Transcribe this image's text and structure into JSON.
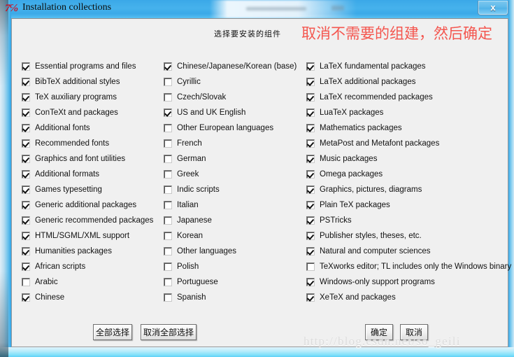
{
  "window": {
    "title": "Installation collections",
    "icon": "texlive-logo-icon",
    "close_label": "x"
  },
  "header": {
    "instruction_cn": "选择要安装的组件",
    "annotation_red": "取消不需要的组建，然后确定",
    "annotation_color": "#f4564f"
  },
  "columns": [
    {
      "name": "collections-column-1",
      "items": [
        {
          "label": "Essential programs and files",
          "checked": true
        },
        {
          "label": "BibTeX additional styles",
          "checked": true
        },
        {
          "label": "TeX auxiliary programs",
          "checked": true
        },
        {
          "label": "ConTeXt and packages",
          "checked": true
        },
        {
          "label": "Additional fonts",
          "checked": true
        },
        {
          "label": "Recommended fonts",
          "checked": true
        },
        {
          "label": "Graphics and font utilities",
          "checked": true
        },
        {
          "label": "Additional formats",
          "checked": true
        },
        {
          "label": "Games typesetting",
          "checked": true
        },
        {
          "label": "Generic additional packages",
          "checked": true
        },
        {
          "label": "Generic recommended packages",
          "checked": true
        },
        {
          "label": "HTML/SGML/XML support",
          "checked": true
        },
        {
          "label": "Humanities packages",
          "checked": true
        },
        {
          "label": "African scripts",
          "checked": true
        },
        {
          "label": "Arabic",
          "checked": false
        },
        {
          "label": "Chinese",
          "checked": true
        }
      ]
    },
    {
      "name": "collections-column-2",
      "items": [
        {
          "label": "Chinese/Japanese/Korean (base)",
          "checked": true
        },
        {
          "label": "Cyrillic",
          "checked": false
        },
        {
          "label": "Czech/Slovak",
          "checked": false
        },
        {
          "label": "US and UK English",
          "checked": true
        },
        {
          "label": "Other European languages",
          "checked": false
        },
        {
          "label": "French",
          "checked": false
        },
        {
          "label": "German",
          "checked": false
        },
        {
          "label": "Greek",
          "checked": false
        },
        {
          "label": "Indic scripts",
          "checked": false
        },
        {
          "label": "Italian",
          "checked": false
        },
        {
          "label": "Japanese",
          "checked": false
        },
        {
          "label": "Korean",
          "checked": false
        },
        {
          "label": "Other languages",
          "checked": false
        },
        {
          "label": "Polish",
          "checked": false
        },
        {
          "label": "Portuguese",
          "checked": false
        },
        {
          "label": "Spanish",
          "checked": false
        }
      ]
    },
    {
      "name": "collections-column-3",
      "items": [
        {
          "label": "LaTeX fundamental packages",
          "checked": true
        },
        {
          "label": "LaTeX additional packages",
          "checked": true
        },
        {
          "label": "LaTeX recommended packages",
          "checked": true
        },
        {
          "label": "LuaTeX packages",
          "checked": true
        },
        {
          "label": "Mathematics packages",
          "checked": true
        },
        {
          "label": "MetaPost and Metafont packages",
          "checked": true
        },
        {
          "label": "Music packages",
          "checked": true
        },
        {
          "label": "Omega packages",
          "checked": true
        },
        {
          "label": "Graphics, pictures, diagrams",
          "checked": true
        },
        {
          "label": "Plain TeX packages",
          "checked": true
        },
        {
          "label": "PSTricks",
          "checked": true
        },
        {
          "label": "Publisher styles, theses, etc.",
          "checked": true
        },
        {
          "label": "Natural and computer sciences",
          "checked": true
        },
        {
          "label": "TeXworks editor; TL includes only the Windows binary",
          "checked": false
        },
        {
          "label": "Windows-only support programs",
          "checked": true
        },
        {
          "label": "XeTeX and packages",
          "checked": true
        }
      ]
    }
  ],
  "buttons": {
    "select_all": "全部选择",
    "deselect_all": "取消全部选择",
    "ok": "确定",
    "cancel": "取消"
  },
  "watermark": "http://blog.csdn.net/so_geili"
}
